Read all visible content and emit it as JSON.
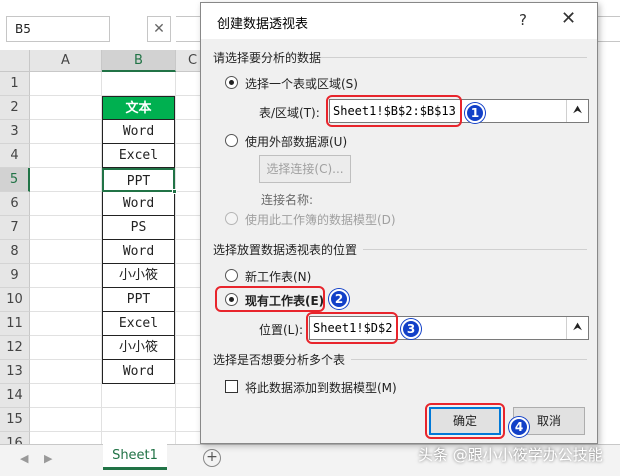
{
  "excel": {
    "name_box": "B5",
    "fx_cancel": "✕",
    "columns": [
      "A",
      "B",
      "C"
    ],
    "rows": [
      "1",
      "2",
      "3",
      "4",
      "5",
      "6",
      "7",
      "8",
      "9",
      "10",
      "11",
      "12",
      "13",
      "14",
      "15",
      "16"
    ],
    "table_header": "文本",
    "table_cells": [
      "Word",
      "Excel",
      "PPT",
      "Word",
      "PS",
      "Word",
      "小小筱",
      "PPT",
      "Excel",
      "小小筱",
      "Word"
    ],
    "sheet_tab": "Sheet1",
    "add_sheet": "+",
    "nav_prev": "◀",
    "nav_next": "▶"
  },
  "dialog": {
    "title": "创建数据透视表",
    "help": "?",
    "close": "✕",
    "section1": "请选择要分析的数据",
    "opt_table_range": "选择一个表或区域(S)",
    "table_range_label": "表/区域(T):",
    "table_range_value": "Sheet1!$B$2:$B$13",
    "opt_external": "使用外部数据源(U)",
    "choose_connection": "选择连接(C)...",
    "connection_name_label": "连接名称:",
    "opt_data_model": "使用此工作簿的数据模型(D)",
    "section2": "选择放置数据透视表的位置",
    "opt_new_sheet": "新工作表(N)",
    "opt_existing_sheet": "现有工作表(E)",
    "location_label": "位置(L):",
    "location_value": "Sheet1!$D$2",
    "section3": "选择是否想要分析多个表",
    "add_to_model": "将此数据添加到数据模型(M)",
    "ok": "确定",
    "cancel": "取消",
    "collapse_icon": "⮝"
  },
  "markers": [
    "1",
    "2",
    "3",
    "4"
  ],
  "watermark": "头条 @跟小小筱学办公技能",
  "colors": {
    "header_green": "#00b050",
    "excel_green": "#217346",
    "highlight_red": "#e8252c",
    "marker_blue": "#1240c8"
  }
}
